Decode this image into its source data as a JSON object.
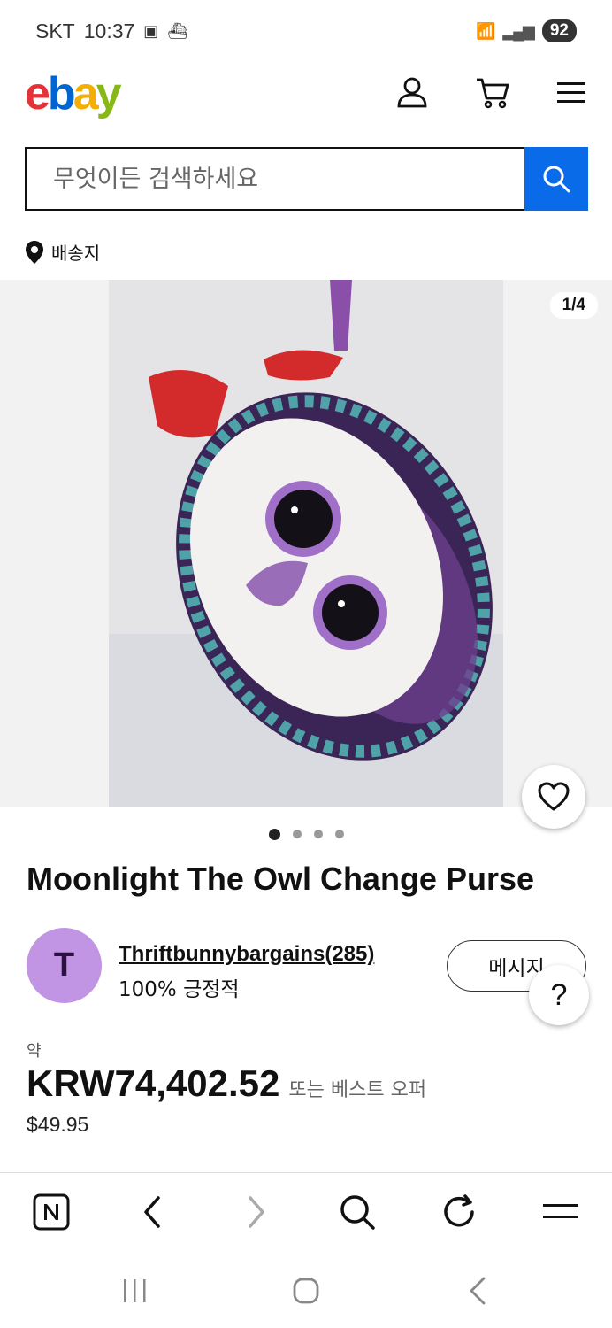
{
  "status_bar": {
    "carrier": "SKT",
    "time": "10:37",
    "battery": "92"
  },
  "header": {
    "logo": {
      "e": "e",
      "b": "b",
      "a": "a",
      "y": "y"
    },
    "icons": [
      "account-icon",
      "cart-icon",
      "menu-icon"
    ]
  },
  "search": {
    "placeholder": "무엇이든 검색하세요"
  },
  "shipping": {
    "label": "배송지"
  },
  "gallery": {
    "counter": "1/4",
    "dots": 4,
    "active_dot": 0
  },
  "product": {
    "title": "Moonlight The Owl Change Purse"
  },
  "seller": {
    "initial": "T",
    "name": "Thriftbunnybargains",
    "feedback_count": "(285)",
    "positive": "100% 긍정적",
    "message_button": "메시지"
  },
  "price": {
    "approx_label": "약",
    "amount": "KRW74,402.52",
    "best_offer": "또는 베스트 오퍼",
    "usd": "$49.95"
  },
  "colors": {
    "search_button": "#0a6be8",
    "avatar": "#c294e4"
  }
}
